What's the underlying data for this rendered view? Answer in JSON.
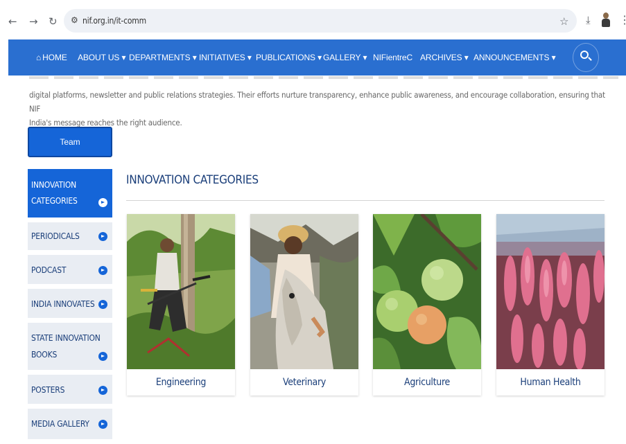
{
  "browser": {
    "url": "nif.org.in/it-comm",
    "icons": [
      "back-arrow-icon",
      "forward-arrow-icon",
      "reload-icon",
      "site-settings-icon",
      "star-icon",
      "download-icon",
      "extension-avatar-icon",
      "kebab-menu-icon"
    ]
  },
  "nav": {
    "items": [
      {
        "label": "HOME",
        "icon": "home-icon"
      },
      {
        "label": "ABOUT US ▾"
      },
      {
        "label": "DEPARTMENTS ▾"
      },
      {
        "label": "INITIATIVES ▾"
      },
      {
        "label": "PUBLICATIONS ▾"
      },
      {
        "label": "GALLERY ▾"
      },
      {
        "label": "NIFientreC"
      },
      {
        "label": "ARCHIVES ▾"
      },
      {
        "label": "ANNOUNCEMENTS ▾"
      }
    ],
    "search_icon": "search-icon",
    "color": "#2a6fd0"
  },
  "intro": {
    "line1": "digital platforms, newsletter and public relations strategies. Their efforts nurture transparency, enhance public awareness, and encourage collaboration, ensuring that NIF",
    "line2": "India's message reaches the right audience."
  },
  "team_button": "Team",
  "sidebar": {
    "items": [
      {
        "label": "INNOVATION CATEGORIES",
        "active": true
      },
      {
        "label": "PERIODICALS"
      },
      {
        "label": "PODCAST"
      },
      {
        "label": "INDIA INNOVATES"
      },
      {
        "label": "STATE INNOVATION BOOKS"
      },
      {
        "label": "POSTERS"
      },
      {
        "label": "MEDIA GALLERY"
      }
    ]
  },
  "section": {
    "title": "INNOVATION CATEGORIES"
  },
  "cards": [
    {
      "caption": "Engineering"
    },
    {
      "caption": "Veterinary"
    },
    {
      "caption": "Agriculture"
    },
    {
      "caption": "Human Health"
    }
  ],
  "colors": {
    "accent": "#1565d8",
    "nav": "#2a6fd0",
    "title_text": "#1b3f7a",
    "sidebar_bg": "#e9edf3"
  }
}
